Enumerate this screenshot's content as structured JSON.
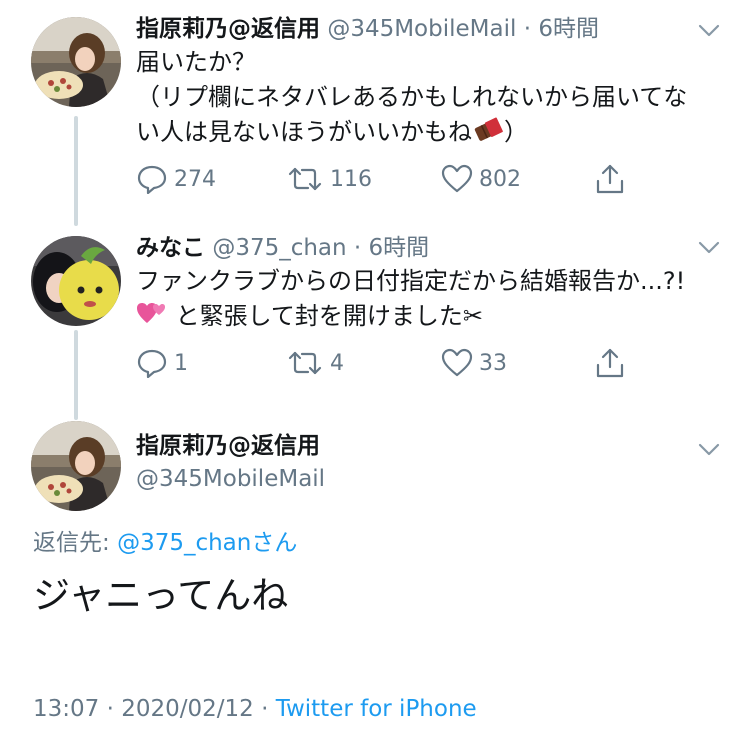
{
  "tweets": [
    {
      "name": "指原莉乃@返信用",
      "handle": "@345MobileMail",
      "dot": "·",
      "time": "6時間",
      "lines": [
        "届いたか？",
        "（リプ欄にネタバレあるかもしれないから届いてな",
        "い人は見ないほうがいいかもね",
        "）"
      ],
      "emoji": "chocolate-bar-icon",
      "replies": "274",
      "retweets": "116",
      "likes": "802"
    },
    {
      "name": "みなこ",
      "handle": "@375_chan",
      "dot": "·",
      "time": "6時間",
      "lines": [
        "ファンクラブからの日付指定だから結婚報告か...?!",
        "と緊張して封を開けました✂"
      ],
      "emoji": "two-hearts-icon",
      "replies": "1",
      "retweets": "4",
      "likes": "33"
    }
  ],
  "main_tweet": {
    "name": "指原莉乃@返信用",
    "handle": "@345MobileMail",
    "replying_prefix": "返信先: ",
    "replying_mention": "@375_chanさん",
    "text": "ジャニってんね",
    "timestamp": "13:07 · 2020/02/12 · ",
    "source": "Twitter for iPhone"
  },
  "colors": {
    "text": "#14171a",
    "secondary": "#657786",
    "link": "#1d9bf0",
    "thread_line": "#cfd9de"
  }
}
